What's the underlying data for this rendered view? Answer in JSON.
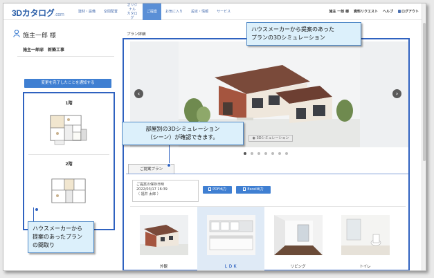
{
  "brand": {
    "name": "3Dカタログ",
    "suffix": ".com"
  },
  "nav": {
    "items": [
      {
        "label": "建材・設備",
        "active": false
      },
      {
        "label": "空間配置",
        "active": false
      },
      {
        "label": "オリジナル\nカタログ",
        "active": false
      },
      {
        "label": "ご提案",
        "active": true
      },
      {
        "label": "お気に入り",
        "active": false
      },
      {
        "label": "設定・情報",
        "active": false
      },
      {
        "label": "サービス",
        "active": false
      }
    ],
    "util": {
      "user": "施主 一郎 様",
      "request": "資料リクエスト",
      "help": "ヘルプ",
      "logout": "ログアウト"
    }
  },
  "sidebar": {
    "user_name": "施主一郎 様",
    "project": "施主一郎邸　新築工事",
    "notify_button": "変更を完了したことを通知する",
    "floors": [
      {
        "label": "1階"
      },
      {
        "label": "2階"
      }
    ]
  },
  "main": {
    "section_label": "プラン詳細",
    "sim_tag": "3Dシミュレーション",
    "tab_label": "ご提案プラン",
    "save_card": {
      "title": "ご提案の保存日時",
      "date": "2022/03/17 16:39",
      "author": "（ 福井 太郎 ）"
    },
    "buttons": {
      "pdf": "PDF出力",
      "excel": "Excel出力"
    },
    "carousel": {
      "count": 7,
      "active_index": 0
    },
    "scenes": [
      {
        "label": "外観",
        "active": false
      },
      {
        "label": "ＬＤＫ",
        "active": true
      },
      {
        "label": "リビング",
        "active": false
      },
      {
        "label": "トイレ",
        "active": false
      }
    ]
  },
  "callouts": {
    "top": "ハウスメーカーから提案のあった\nプランの3Dシミュレーション",
    "middle": "部屋別の3Dシミュレーション\n（シーン）が確認できます。",
    "left": "ハウスメーカーから\n提案のあったプラン\nの間取り"
  },
  "colors": {
    "accent": "#3f7fd2",
    "highlight": "#2f62c0",
    "callout_bg": "#dcf0fb",
    "active_scene": "#dfeaf6"
  }
}
